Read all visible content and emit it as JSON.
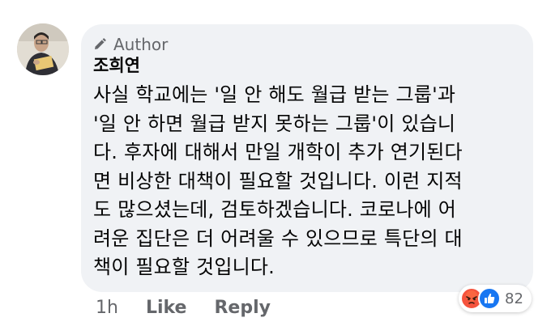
{
  "comment": {
    "badge_label": "Author",
    "author_name": "조희연",
    "lines": [
      "사실 학교에는 '일 안 해도 월급 받는 그룹'과",
      "'일 안 하면 월급 받지 못하는 그룹'이 있습니",
      "다. 후자에 대해서 만일 개학이 추가 연기된다",
      "면 비상한 대책이 필요할 것입니다. 이런 지적",
      "도 많으셨는데, 검토하겠습니다. 코로나에 어",
      "려운 집단은 더 어려울 수 있으므로 특단의 대",
      "책이 필요할 것입니다."
    ]
  },
  "actions": {
    "time": "1h",
    "like_label": "Like",
    "reply_label": "Reply"
  },
  "reactions": {
    "icons": [
      "angry-icon",
      "like-icon"
    ],
    "count": "82"
  },
  "colors": {
    "bubble": "#f0f2f5",
    "secondary_text": "#65676b",
    "like_blue": "#1877f2",
    "angry_red": "#f5533d"
  }
}
